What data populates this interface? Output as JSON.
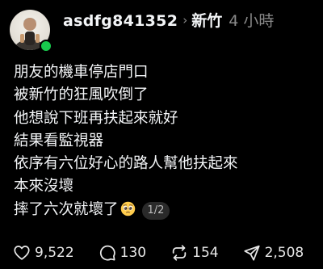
{
  "post": {
    "username": "asdfg841352",
    "community": "新竹",
    "time": "4 小時",
    "lines": [
      "朋友的機車停店門口",
      "被新竹的狂風吹倒了",
      "他想說下班再扶起來就好",
      "結果看監視器",
      "依序有六位好心的路人幫他扶起來",
      "本來沒壞",
      "摔了六次就壞了"
    ],
    "last_line_emoji": "pleading-face-emoji",
    "page_indicator": "1/2"
  },
  "actions": {
    "likes": "9,522",
    "comments": "130",
    "reposts": "154",
    "shares": "2,508"
  },
  "colors": {
    "background": "#000000",
    "text": "#f3f5f7",
    "muted": "#8a8a8a",
    "online": "#18c94d"
  }
}
